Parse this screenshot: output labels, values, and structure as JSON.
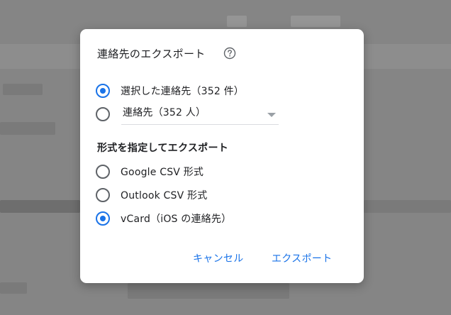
{
  "dialog": {
    "title": "連絡先のエクスポート",
    "scope_options": [
      {
        "label": "選択した連絡先（352 件）",
        "checked": true
      },
      {
        "label": "",
        "checked": false
      }
    ],
    "contacts_select_value": "連絡先（352 人）",
    "format_heading": "形式を指定してエクスポート",
    "format_options": [
      {
        "label": "Google CSV 形式",
        "checked": false
      },
      {
        "label": "Outlook CSV 形式",
        "checked": false
      },
      {
        "label": "vCard（iOS の連絡先）",
        "checked": true
      }
    ],
    "cancel_label": "キャンセル",
    "export_label": "エクスポート"
  },
  "colors": {
    "accent": "#1a73e8",
    "overlay": "#858585"
  },
  "icons": {
    "help": "help-circle-icon",
    "dropdown": "chevron-down-icon"
  }
}
